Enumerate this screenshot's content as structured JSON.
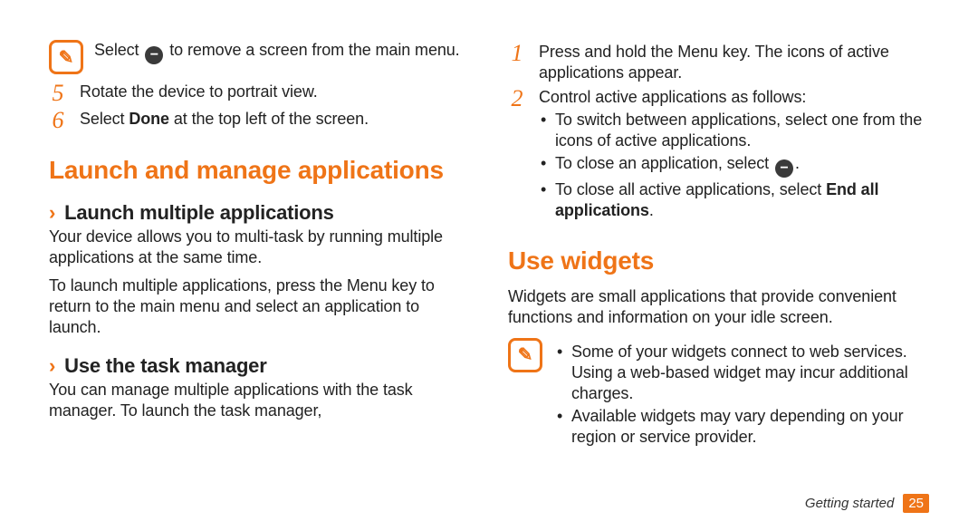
{
  "leftColumn": {
    "note1": {
      "pre": "Select ",
      "post": " to remove a screen from the main menu."
    },
    "step5": {
      "num": "5",
      "text": "Rotate the device to portrait view."
    },
    "step6": {
      "num": "6",
      "pre": "Select ",
      "bold": "Done",
      "post": " at the top left of the screen."
    },
    "h1": "Launch and manage applications",
    "sub1": {
      "title": "Launch multiple applications",
      "p1": "Your device allows you to multi-task by running multiple applications at the same time.",
      "p2": "To launch multiple applications, press the Menu key to return to the main menu and select an application to launch."
    },
    "sub2": {
      "title": "Use the task manager",
      "p1": "You can manage multiple applications with the task manager. To launch the task manager,"
    }
  },
  "rightColumn": {
    "step1": {
      "num": "1",
      "text": "Press and hold the Menu key. The icons of active applications appear."
    },
    "step2": {
      "num": "2",
      "lead": "Control active applications as follows:",
      "b1": "To switch between applications, select one from the icons of active applications.",
      "b2_pre": "To close an application, select ",
      "b2_post": ".",
      "b3_pre": "To close all active applications, select ",
      "b3_bold": "End all applications",
      "b3_post": "."
    },
    "h1": "Use widgets",
    "p1": "Widgets are small applications that provide convenient functions and information on your idle screen.",
    "note": {
      "b1": "Some of your widgets connect to web services. Using a web-based widget may incur additional charges.",
      "b2": "Available widgets may vary depending on your region or service provider."
    }
  },
  "footer": {
    "section": "Getting started",
    "page": "25"
  },
  "icons": {
    "note": "✎",
    "minus": "−"
  }
}
